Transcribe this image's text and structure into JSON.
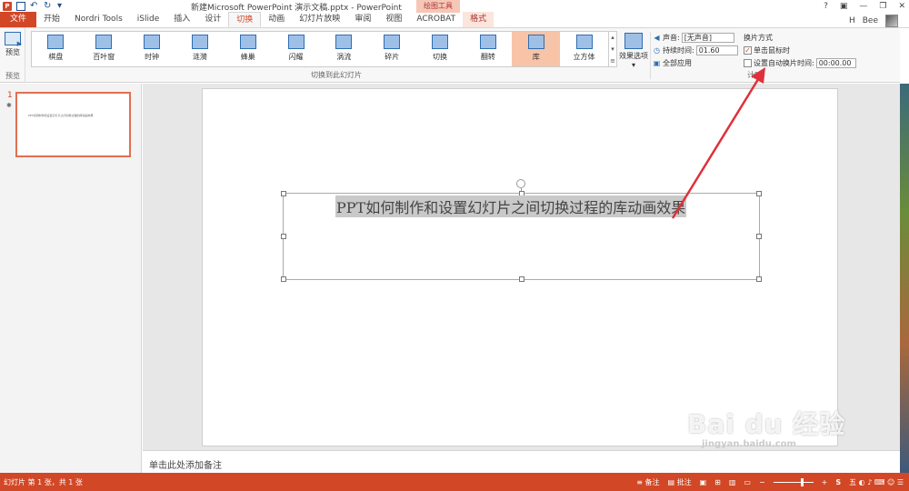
{
  "window": {
    "title": "新建Microsoft PowerPoint 演示文稿.pptx - PowerPoint",
    "contextual_tab_group": "绘图工具",
    "help": "?",
    "controls": [
      "▣",
      "—",
      "❐",
      "✕"
    ]
  },
  "tabs": [
    {
      "label": "文件",
      "kind": "file"
    },
    {
      "label": "开始",
      "kind": "normal"
    },
    {
      "label": "Nordri Tools",
      "kind": "normal"
    },
    {
      "label": "iSlide",
      "kind": "normal"
    },
    {
      "label": "插入",
      "kind": "normal"
    },
    {
      "label": "设计",
      "kind": "normal"
    },
    {
      "label": "切换",
      "kind": "active"
    },
    {
      "label": "动画",
      "kind": "normal"
    },
    {
      "label": "幻灯片放映",
      "kind": "normal"
    },
    {
      "label": "审阅",
      "kind": "normal"
    },
    {
      "label": "视图",
      "kind": "normal"
    },
    {
      "label": "ACROBAT",
      "kind": "normal"
    },
    {
      "label": "格式",
      "kind": "format"
    }
  ],
  "user": {
    "name": "Bee",
    "initial": "H"
  },
  "ribbon": {
    "preview": {
      "button": "预览",
      "group": "预览"
    },
    "gallery_group": "切换到此幻灯片",
    "gallery": [
      "棋盘",
      "百叶窗",
      "时钟",
      "涟漪",
      "蜂巢",
      "闪耀",
      "涡流",
      "碎片",
      "切换",
      "翻转",
      "库",
      "立方体"
    ],
    "selected": "库",
    "effect_options": "效果选项",
    "timing": {
      "sound_label": "声音:",
      "sound_value": "[无声音]",
      "duration_label": "持续时间:",
      "duration_value": "01.60",
      "apply_all": "全部应用"
    },
    "advance": {
      "title": "换片方式",
      "on_click": "单击鼠标时",
      "on_click_checked": true,
      "after_label": "设置自动换片时间:",
      "after_value": "00:00.00",
      "after_checked": false,
      "group": "计时"
    }
  },
  "slides_pane": {
    "number": "1",
    "star": "✱",
    "thumb_text": "PPT如何制作和设置幻灯片之间切换过程的库动画效果"
  },
  "slide": {
    "title": "PPT如何制作和设置幻灯片之间切换过程的库动画效果"
  },
  "notes": {
    "placeholder": "单击此处添加备注"
  },
  "status": {
    "slide_info": "幻灯片 第 1 张，共 1 张",
    "notes_btn": "备注",
    "comments_btn": "批注"
  },
  "watermark": {
    "main": "Bai du 经验",
    "sub": "jingyan.baidu.com"
  },
  "colors": {
    "accent": "#d24726",
    "selected": "#f7c4a8"
  }
}
